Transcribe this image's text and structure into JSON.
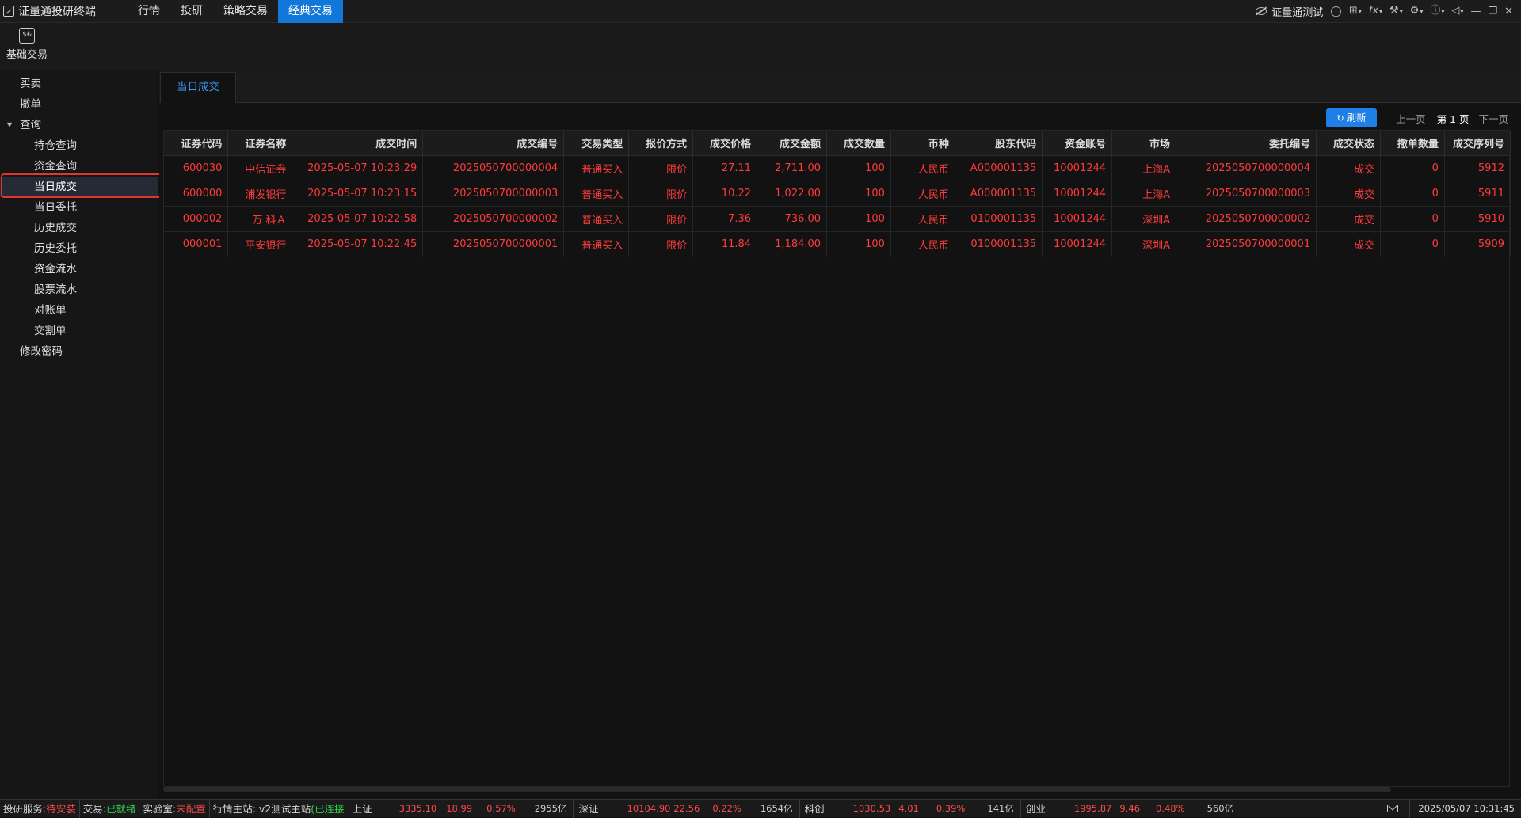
{
  "app": {
    "title": "证量通投研终端"
  },
  "topmenu": [
    {
      "label": "行情",
      "active": false
    },
    {
      "label": "投研",
      "active": false
    },
    {
      "label": "策略交易",
      "active": false
    },
    {
      "label": "经典交易",
      "active": true
    }
  ],
  "titlebar_right": {
    "user": "证量通测试",
    "icons": [
      "eye-off-icon",
      "user-icon",
      "grid-icon",
      "fx-icon",
      "wrench-icon",
      "gear-icon",
      "help-icon",
      "back-icon",
      "minimize-icon",
      "restore-icon",
      "close-icon"
    ]
  },
  "toolbar": {
    "basic_trade_label": "基础交易",
    "basic_trade_icon_glyph": "$₺"
  },
  "sidebar": {
    "items": [
      {
        "label": "买卖",
        "level": 1
      },
      {
        "label": "撤单",
        "level": 1
      },
      {
        "label": "查询",
        "level": 1,
        "group": true
      },
      {
        "label": "持仓查询",
        "level": 2
      },
      {
        "label": "资金查询",
        "level": 2
      },
      {
        "label": "当日成交",
        "level": 2,
        "active": true
      },
      {
        "label": "当日委托",
        "level": 2
      },
      {
        "label": "历史成交",
        "level": 2
      },
      {
        "label": "历史委托",
        "level": 2
      },
      {
        "label": "资金流水",
        "level": 2
      },
      {
        "label": "股票流水",
        "level": 2
      },
      {
        "label": "对账单",
        "level": 2
      },
      {
        "label": "交割单",
        "level": 2
      },
      {
        "label": "修改密码",
        "level": 1
      }
    ]
  },
  "main": {
    "tab_label": "当日成交",
    "refresh_label": "刷新",
    "prev_page": "上一页",
    "current_page": "第 1 页",
    "next_page": "下一页"
  },
  "table": {
    "columns": [
      "证券代码",
      "证券名称",
      "成交时间",
      "成交编号",
      "交易类型",
      "报价方式",
      "成交价格",
      "成交金额",
      "成交数量",
      "币种",
      "股东代码",
      "资金账号",
      "市场",
      "委托编号",
      "成交状态",
      "撤单数量",
      "成交序列号"
    ],
    "rows": [
      [
        "600030",
        "中信证券",
        "2025-05-07 10:23:29",
        "2025050700000004",
        "普通买入",
        "限价",
        "27.11",
        "2,711.00",
        "100",
        "人民币",
        "A000001135",
        "10001244",
        "上海A",
        "2025050700000004",
        "成交",
        "0",
        "5912"
      ],
      [
        "600000",
        "浦发银行",
        "2025-05-07 10:23:15",
        "2025050700000003",
        "普通买入",
        "限价",
        "10.22",
        "1,022.00",
        "100",
        "人民币",
        "A000001135",
        "10001244",
        "上海A",
        "2025050700000003",
        "成交",
        "0",
        "5911"
      ],
      [
        "000002",
        "万 科Ａ",
        "2025-05-07 10:22:58",
        "2025050700000002",
        "普通买入",
        "限价",
        "7.36",
        "736.00",
        "100",
        "人民币",
        "0100001135",
        "10001244",
        "深圳A",
        "2025050700000002",
        "成交",
        "0",
        "5910"
      ],
      [
        "000001",
        "平安银行",
        "2025-05-07 10:22:45",
        "2025050700000001",
        "普通买入",
        "限价",
        "11.84",
        "1,184.00",
        "100",
        "人民币",
        "0100001135",
        "10001244",
        "深圳A",
        "2025050700000001",
        "成交",
        "0",
        "5909"
      ]
    ],
    "row_color": "#ff3b3b"
  },
  "statusbar": {
    "research_label": "投研服务:",
    "research_status": "待安装",
    "trade_label": "交易:",
    "trade_status": "已就绪",
    "lab_label": "实验室:",
    "lab_status": "未配置",
    "quote_label": "行情主站: v2测试主站",
    "quote_status": "(已连接",
    "indices": [
      {
        "name": "上证",
        "price": "3335.10",
        "change": "18.99",
        "pct": "0.57%",
        "amount": "2955亿"
      },
      {
        "name": "深证",
        "price": "10104.90",
        "change": "22.56",
        "pct": "0.22%",
        "amount": "1654亿"
      },
      {
        "name": "科创",
        "price": "1030.53",
        "change": "4.01",
        "pct": "0.39%",
        "amount": "141亿"
      },
      {
        "name": "创业",
        "price": "1995.87",
        "change": "9.46",
        "pct": "0.48%",
        "amount": "560亿"
      }
    ],
    "datetime": "2025/05/07  10:31:45"
  },
  "colors": {
    "accent": "#1177d9",
    "rise": "#ff3b3b",
    "ok": "#2ed14c",
    "highlight": "#e0352b"
  }
}
